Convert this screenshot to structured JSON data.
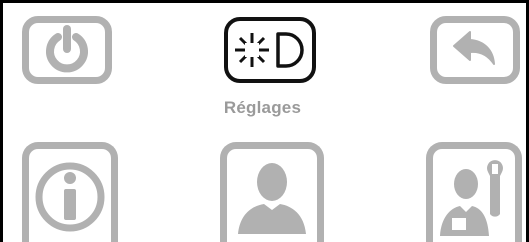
{
  "colors": {
    "tile_border": "#b1b1b1",
    "icon_fill": "#b1b1b1",
    "selected_border": "#111111",
    "selected_icon": "#111111",
    "label_color": "#9a9a9a"
  },
  "menu": {
    "selected_label": "Réglages",
    "tiles": [
      {
        "name": "power-button",
        "icon": "power-icon",
        "selected": false
      },
      {
        "name": "settings-button",
        "icon": "brightness-moon-icon",
        "selected": true
      },
      {
        "name": "back-button",
        "icon": "back-arrow-icon",
        "selected": false
      },
      {
        "name": "info-button",
        "icon": "info-icon",
        "selected": false
      },
      {
        "name": "user-profile-button",
        "icon": "user-icon",
        "selected": false
      },
      {
        "name": "maintenance-button",
        "icon": "technician-wrench-icon",
        "selected": false
      }
    ]
  }
}
